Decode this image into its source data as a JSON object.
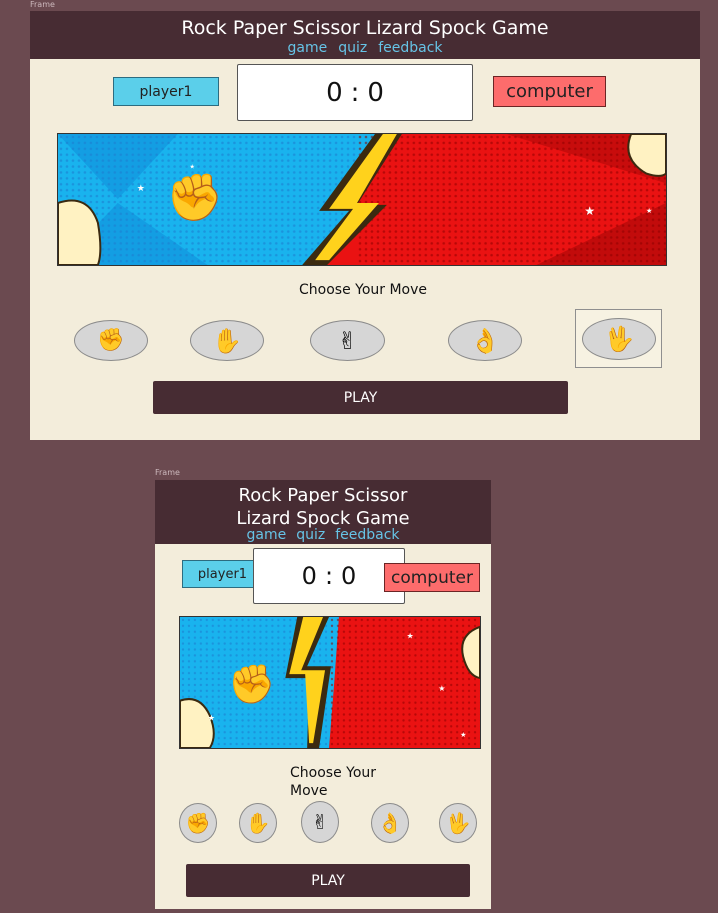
{
  "frame_label": "Frame",
  "game": {
    "title": "Rock Paper Scissor Lizard Spock Game",
    "title_line1": "Rock Paper Scissor",
    "title_line2": "Lizard Spock Game",
    "nav": [
      "game",
      "quiz",
      "feedback"
    ],
    "player_label": "player1",
    "computer_label": "computer",
    "score_player": "0",
    "score_sep": ":",
    "score_computer": "0",
    "choose_label": "Choose Your Move",
    "choose_line1": "Choose Your",
    "choose_line2": "Move",
    "play_label": "PLAY",
    "moves": [
      {
        "name": "rock",
        "icon": "raised-fist-icon"
      },
      {
        "name": "paper",
        "icon": "raised-hand-icon"
      },
      {
        "name": "scissors",
        "icon": "victory-hand-icon"
      },
      {
        "name": "lizard",
        "icon": "pinching-hand-icon"
      },
      {
        "name": "spock",
        "icon": "vulcan-salute-icon"
      }
    ],
    "selected_move": "spock"
  },
  "colors": {
    "header": "#472c33",
    "nav_link": "#66c3e6",
    "player": "#5bcfea",
    "computer": "#fd6c6c",
    "frame_bg": "#f3eddb",
    "page_bg": "#6b4a50"
  }
}
